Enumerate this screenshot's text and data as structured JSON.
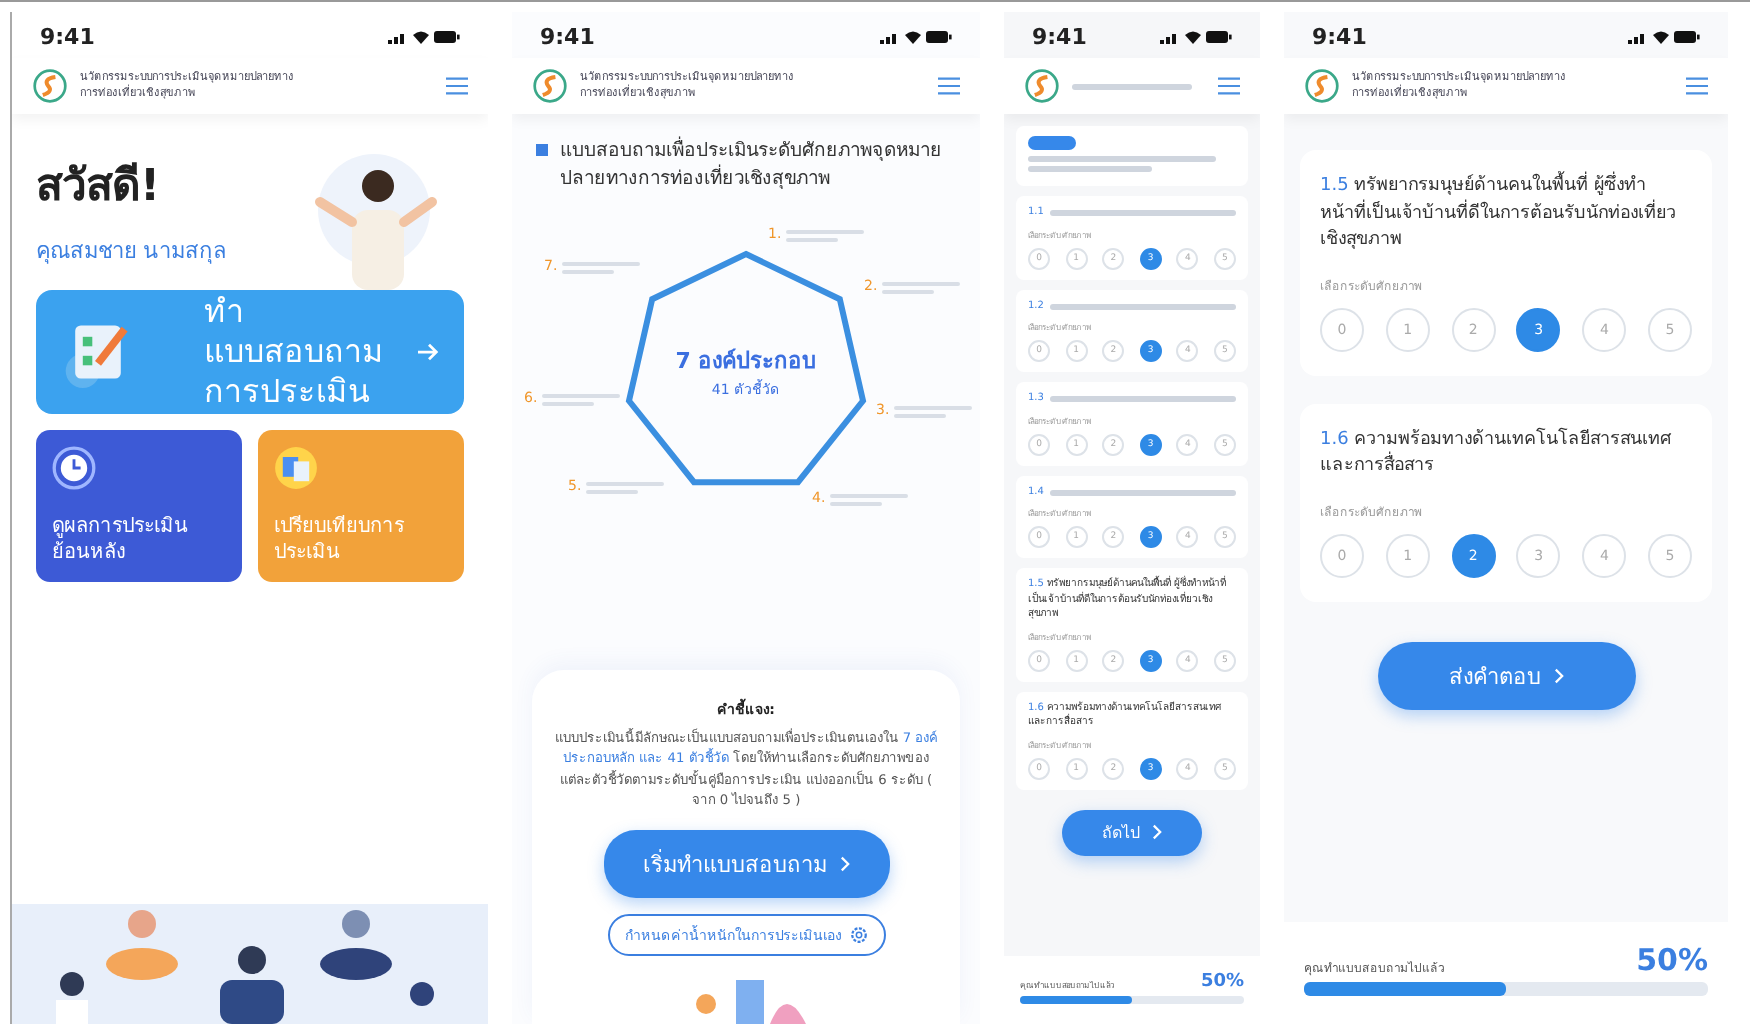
{
  "screens": [
    {
      "kind": "home",
      "time": "9:41",
      "app_title": [
        "นวัตกรรมระบบการประเมินจุดหมายปลายทาง",
        "การท่องเที่ยวเชิงสุขภาพ"
      ],
      "greeting": "สวัสดี!",
      "user_name": "คุณสมชาย นามสกุล",
      "main_action": [
        "ทำแบบสอบถาม",
        "การประเมิน"
      ],
      "tiles": [
        {
          "label": [
            "ดูผลการประเมิน",
            "ย้อนหลัง"
          ],
          "color": "#3d5ad6"
        },
        {
          "label": [
            "เปรียบเทียบการ",
            "ประเมิน"
          ],
          "color": "#f2a23a"
        }
      ]
    },
    {
      "kind": "intro",
      "time": "9:41",
      "app_title": [
        "นวัตกรรมระบบการประเมินจุดหมายปลายทาง",
        "การท่องเที่ยวเชิงสุขภาพ"
      ],
      "heading": "แบบสอบถามเพื่อประเมินระดับศักยภาพจุดหมายปลายทางการท่องเที่ยวเชิงสุขภาพ",
      "center_title": "7 องค์ประกอบ",
      "center_subtitle": "41 ตัวชี้วัด",
      "component_numbers": [
        "1.",
        "2.",
        "3.",
        "4.",
        "5.",
        "6.",
        "7."
      ],
      "note_title": "คำชี้แจง:",
      "note_parts": [
        {
          "text": "แบบประเมินนี้มีลักษณะเป็นแบบสอบถามเพื่อประเมินตนเองใน ",
          "highlight": false
        },
        {
          "text": "7 องค์ประกอบหลัก และ 41 ตัวชี้วัด",
          "highlight": true
        },
        {
          "text": " โดยให้ท่านเลือกระดับศักยภาพของแต่ละตัวชี้วัดตามระดับขั้นคู่มือการประเมิน แบ่งออกเป็น 6 ระดับ ( จาก 0 ไปจนถึง 5 )",
          "highlight": false
        }
      ],
      "start_button": "เริ่มทำแบบสอบถาม",
      "settings_button": "กำหนดค่าน้ำหนักในการประเมินเอง"
    },
    {
      "kind": "questions_mini",
      "time": "9:41",
      "questions": [
        {
          "number": "1.1",
          "prompt": "เลือกระดับศักยภาพ",
          "options": [
            {
              "label": "0",
              "selected": false
            },
            {
              "label": "1",
              "selected": false
            },
            {
              "label": "2",
              "selected": false
            },
            {
              "label": "3",
              "selected": true
            },
            {
              "label": "4",
              "selected": false
            },
            {
              "label": "5",
              "selected": false
            }
          ]
        },
        {
          "number": "1.2",
          "prompt": "เลือกระดับศักยภาพ",
          "options": [
            {
              "label": "0",
              "selected": false
            },
            {
              "label": "1",
              "selected": false
            },
            {
              "label": "2",
              "selected": false
            },
            {
              "label": "3",
              "selected": true
            },
            {
              "label": "4",
              "selected": false
            },
            {
              "label": "5",
              "selected": false
            }
          ]
        },
        {
          "number": "1.3",
          "prompt": "เลือกระดับศักยภาพ",
          "options": [
            {
              "label": "0",
              "selected": false
            },
            {
              "label": "1",
              "selected": false
            },
            {
              "label": "2",
              "selected": false
            },
            {
              "label": "3",
              "selected": true
            },
            {
              "label": "4",
              "selected": false
            },
            {
              "label": "5",
              "selected": false
            }
          ]
        },
        {
          "number": "1.4",
          "prompt": "เลือกระดับศักยภาพ",
          "options": [
            {
              "label": "0",
              "selected": false
            },
            {
              "label": "1",
              "selected": false
            },
            {
              "label": "2",
              "selected": false
            },
            {
              "label": "3",
              "selected": true
            },
            {
              "label": "4",
              "selected": false
            },
            {
              "label": "5",
              "selected": false
            }
          ]
        },
        {
          "number": "1.5",
          "text": "ทรัพยากรมนุษย์ด้านคนในพื้นที่ ผู้ซึ่งทำหน้าที่เป็นเจ้าบ้านที่ดีในการต้อนรับนักท่องเที่ยวเชิงสุขภาพ",
          "prompt": "เลือกระดับศักยภาพ",
          "options": [
            {
              "label": "0",
              "selected": false
            },
            {
              "label": "1",
              "selected": false
            },
            {
              "label": "2",
              "selected": false
            },
            {
              "label": "3",
              "selected": true
            },
            {
              "label": "4",
              "selected": false
            },
            {
              "label": "5",
              "selected": false
            }
          ]
        },
        {
          "number": "1.6",
          "text": "ความพร้อมทางด้านเทคโนโลยีสารสนเทศและการสื่อสาร",
          "prompt": "เลือกระดับศักยภาพ",
          "options": [
            {
              "label": "0",
              "selected": false
            },
            {
              "label": "1",
              "selected": false
            },
            {
              "label": "2",
              "selected": false
            },
            {
              "label": "3",
              "selected": true
            },
            {
              "label": "4",
              "selected": false
            },
            {
              "label": "5",
              "selected": false
            }
          ]
        }
      ],
      "next_button": "ถัดไป",
      "progress": {
        "label": "คุณทำแบบสอบถามไปแล้ว",
        "value": "50%",
        "level": 0.5
      }
    },
    {
      "kind": "questions",
      "time": "9:41",
      "app_title": [
        "นวัตกรรมระบบการประเมินจุดหมายปลายทาง",
        "การท่องเที่ยวเชิงสุขภาพ"
      ],
      "questions": [
        {
          "number": "1.5",
          "text": "ทรัพยากรมนุษย์ด้านคนในพื้นที่ ผู้ซึ่งทำหน้าที่เป็นเจ้าบ้านที่ดีในการต้อนรับนักท่องเที่ยวเชิงสุขภาพ",
          "prompt": "เลือกระดับศักยภาพ",
          "options": [
            {
              "label": "0",
              "selected": false
            },
            {
              "label": "1",
              "selected": false
            },
            {
              "label": "2",
              "selected": false
            },
            {
              "label": "3",
              "selected": true
            },
            {
              "label": "4",
              "selected": false
            },
            {
              "label": "5",
              "selected": false
            }
          ]
        },
        {
          "number": "1.6",
          "text": "ความพร้อมทางด้านเทคโนโลยีสารสนเทศและการสื่อสาร",
          "prompt": "เลือกระดับศักยภาพ",
          "options": [
            {
              "label": "0",
              "selected": false
            },
            {
              "label": "1",
              "selected": false
            },
            {
              "label": "2",
              "selected": true
            },
            {
              "label": "3",
              "selected": false
            },
            {
              "label": "4",
              "selected": false
            },
            {
              "label": "5",
              "selected": false
            }
          ]
        }
      ],
      "submit_button": "ส่งคำตอบ",
      "progress": {
        "label": "คุณทำแบบสอบถามไปแล้ว",
        "value": "50%",
        "level": 0.5
      }
    }
  ]
}
